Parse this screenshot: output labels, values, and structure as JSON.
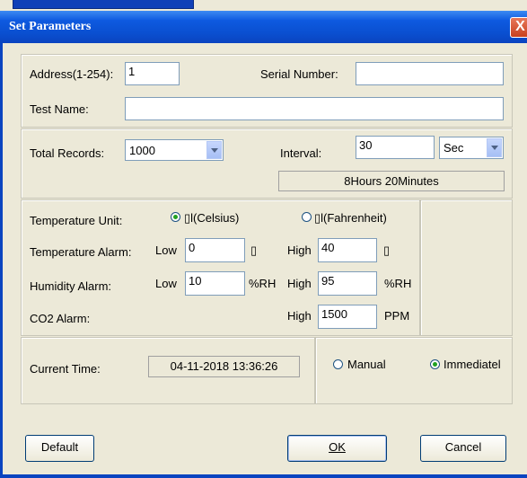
{
  "window": {
    "title": "Set Parameters",
    "close_glyph": "X"
  },
  "identity": {
    "address_label": "Address(1-254):",
    "address_value": "1",
    "serial_label": "Serial Number:",
    "serial_value": "",
    "test_name_label": "Test Name:",
    "test_name_value": ""
  },
  "records": {
    "total_label": "Total Records:",
    "total_value": "1000",
    "interval_label": "Interval:",
    "interval_value": "30",
    "interval_unit": "Sec",
    "duration_text": "8Hours 20Minutes"
  },
  "alarms": {
    "temp_unit_label": "Temperature Unit:",
    "celsius_label": "▯l(Celsius)",
    "fahrenheit_label": "▯l(Fahrenheit)",
    "temp_alarm_label": "Temperature Alarm:",
    "temp_low_label": "Low",
    "temp_low_value": "0",
    "temp_low_unit": "▯",
    "temp_high_label": "High",
    "temp_high_value": "40",
    "temp_high_unit": "▯",
    "hum_alarm_label": "Humidity Alarm:",
    "hum_low_label": "Low",
    "hum_low_value": "10",
    "hum_low_unit": "%RH",
    "hum_high_label": "High",
    "hum_high_value": "95",
    "hum_high_unit": "%RH",
    "co2_alarm_label": "CO2 Alarm:",
    "co2_high_label": "High",
    "co2_high_value": "1500",
    "co2_unit": "PPM"
  },
  "time": {
    "current_label": "Current Time:",
    "current_value": "04-11-2018 13:36:26",
    "manual_label": "Manual",
    "immediate_label": "Immediatel"
  },
  "buttons": {
    "default_label": "Default",
    "ok_label": "OK",
    "cancel_label": "Cancel"
  }
}
